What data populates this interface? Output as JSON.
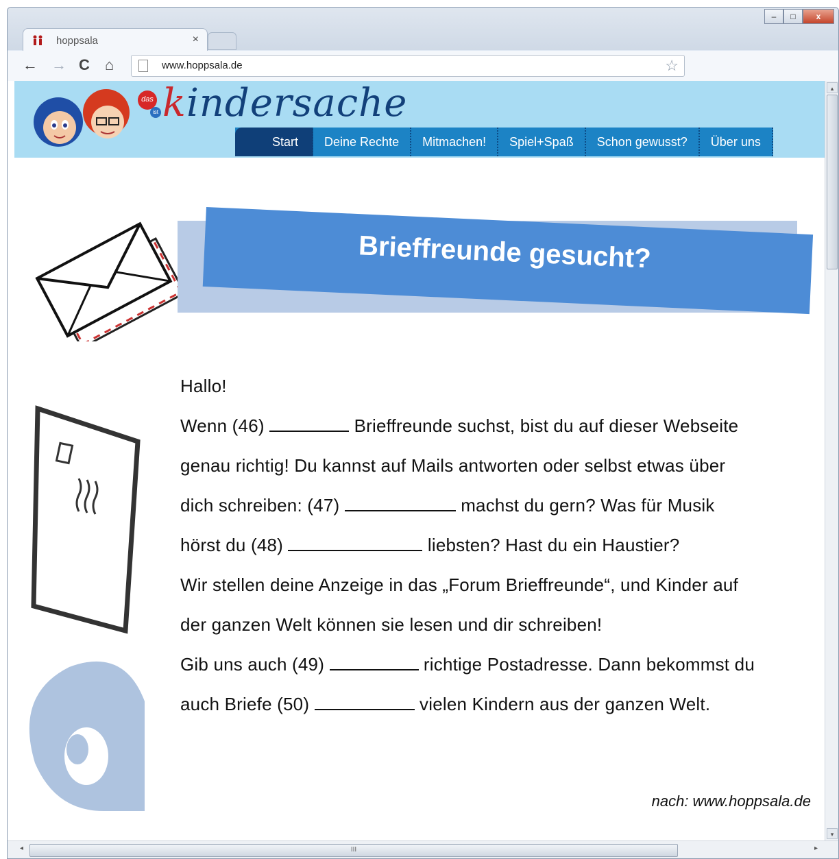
{
  "browser": {
    "tab_title": "hoppsala",
    "tab_close": "×",
    "url": "www.hoppsala.de",
    "back": "←",
    "forward": "→",
    "reload": "C",
    "home": "⌂",
    "star": "☆",
    "minimize": "–",
    "maximize": "□",
    "close": "x"
  },
  "site": {
    "brand_das": "das",
    "brand_ist": "ist",
    "brand_k": "k",
    "brand_rest": "indersache",
    "nav": [
      "Start",
      "Deine Rechte",
      "Mitmachen!",
      "Spiel+Spaß",
      "Schon gewusst?",
      "Über uns"
    ]
  },
  "content": {
    "title": "Brieffreunde gesucht?",
    "greeting": "Hallo!",
    "lines": [
      {
        "pre": "Wenn (46) ",
        "post": " Brieffreunde suchst, bist du auf dieser Webseite"
      },
      {
        "pre": "genau richtig! Du kannst auf Mails antworten oder selbst etwas über",
        "post": ""
      },
      {
        "pre": "dich schreiben: (47) ",
        "post": " machst du gern? Was für Musik"
      },
      {
        "pre": "hörst du (48) ",
        "post": " liebsten? Hast du ein Haustier?"
      },
      {
        "pre": "Wir stellen deine Anzeige in das „Forum Brieffreunde“, und Kinder auf",
        "post": ""
      },
      {
        "pre": "der ganzen Welt können sie lesen und dir schreiben!",
        "post": ""
      },
      {
        "pre": "Gib uns auch (49) ",
        "post": " richtige Postadresse. Dann bekommst du"
      },
      {
        "pre": "auch Briefe (50) ",
        "post": " vielen Kindern aus der ganzen Welt."
      }
    ],
    "credit": "nach: www.hoppsala.de"
  },
  "scrollbar": {
    "grip": "III",
    "left": "◂",
    "right": "▸",
    "up": "▴",
    "down": "▾"
  },
  "colors": {
    "header_bg": "#a9dcf3",
    "nav_bg": "#1c83c5",
    "nav_active": "#0f3f78",
    "banner": "#4d8cd6",
    "banner_back": "#b8cbe6"
  }
}
